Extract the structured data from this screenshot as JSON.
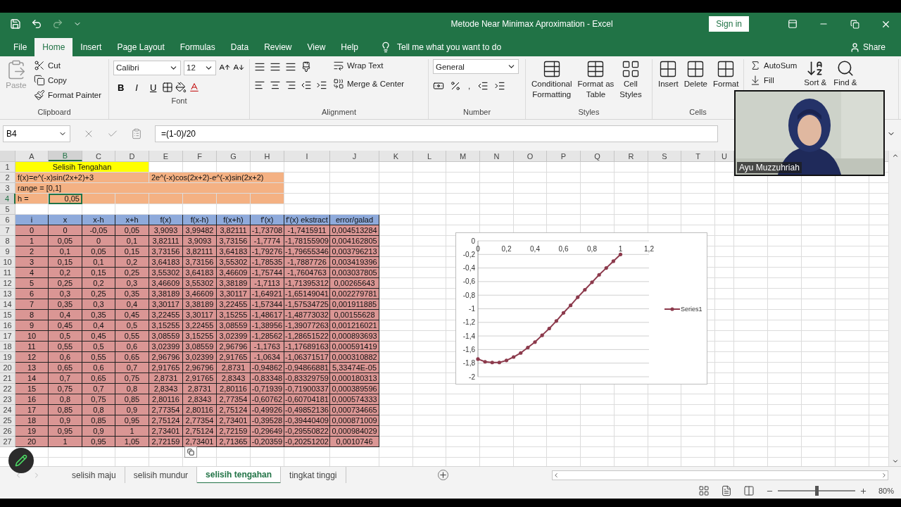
{
  "window": {
    "title": "Metode Near Minimax Aproximation  -  Excel",
    "sign_in": "Sign in",
    "share": "Share"
  },
  "tabs": [
    {
      "label": "File",
      "selected": false
    },
    {
      "label": "Home",
      "selected": true
    },
    {
      "label": "Insert",
      "selected": false
    },
    {
      "label": "Page Layout",
      "selected": false
    },
    {
      "label": "Formulas",
      "selected": false
    },
    {
      "label": "Data",
      "selected": false
    },
    {
      "label": "Review",
      "selected": false
    },
    {
      "label": "View",
      "selected": false
    },
    {
      "label": "Help",
      "selected": false
    }
  ],
  "tell_me": "Tell me what you want to do",
  "clipboard": {
    "label": "Clipboard",
    "paste": {
      "label": "Paste",
      "disabled": true
    },
    "cut": "Cut",
    "copy": "Copy",
    "format_painter": "Format Painter"
  },
  "font": {
    "label": "Font",
    "name": "Calibri",
    "size": "12",
    "styles": [
      "B",
      "I",
      "U"
    ]
  },
  "alignment": {
    "label": "Alignment",
    "wrap": "Wrap Text",
    "merge": "Merge & Center"
  },
  "number": {
    "label": "Number",
    "format": "General",
    "comma": ","
  },
  "styles": {
    "label": "Styles",
    "buttons": [
      [
        "Conditional",
        "Formatting"
      ],
      [
        "Format as",
        "Table"
      ],
      [
        "Cell",
        "Styles"
      ]
    ]
  },
  "cells": {
    "label": "Cells",
    "buttons": [
      "Insert",
      "Delete",
      "Format"
    ]
  },
  "editing": {
    "autosum": "AutoSum",
    "fill": "Fill",
    "buttons": [
      "Sort &",
      "Find &"
    ]
  },
  "formula_bar": {
    "name_box": "B4",
    "formula": "=(1-0)/20"
  },
  "sheet": {
    "columns": [
      {
        "label": "A",
        "selected": false
      },
      {
        "label": "B",
        "selected": true
      },
      {
        "label": "C",
        "selected": false
      },
      {
        "label": "D",
        "selected": false
      },
      {
        "label": "E",
        "selected": false
      },
      {
        "label": "F",
        "selected": false
      },
      {
        "label": "G",
        "selected": false
      },
      {
        "label": "H",
        "selected": false
      },
      {
        "label": "I",
        "selected": false
      },
      {
        "label": "J",
        "selected": false
      },
      {
        "label": "K",
        "selected": false
      },
      {
        "label": "L",
        "selected": false
      },
      {
        "label": "M",
        "selected": false
      },
      {
        "label": "N",
        "selected": false
      },
      {
        "label": "O",
        "selected": false
      },
      {
        "label": "P",
        "selected": false
      },
      {
        "label": "Q",
        "selected": false
      },
      {
        "label": "R",
        "selected": false
      },
      {
        "label": "S",
        "selected": false
      },
      {
        "label": "T",
        "selected": false
      },
      {
        "label": "U",
        "selected": false
      }
    ],
    "rows": [
      {
        "label": "1",
        "selected": false,
        "kind": "title",
        "cells": [
          {
            "text": "Selisih Tengahan"
          },
          {
            "text": ""
          },
          {
            "text": ""
          },
          {
            "text": ""
          }
        ]
      },
      {
        "label": "2",
        "selected": false,
        "kind": "note",
        "cells": [
          {
            "text": "f(x)=e^(-x)sin(2x+2)+3"
          },
          {
            "text": ""
          },
          {
            "text": ""
          },
          {
            "text": ""
          },
          {
            "text": "2e^(-x)cos(2x+2)-e^(-x)sin(2x+2)"
          },
          {
            "text": ""
          },
          {
            "text": ""
          },
          {
            "text": ""
          }
        ]
      },
      {
        "label": "3",
        "selected": false,
        "kind": "note",
        "cells": [
          {
            "text": "range = [0,1]"
          },
          {
            "text": ""
          },
          {
            "text": ""
          },
          {
            "text": ""
          },
          {
            "text": ""
          },
          {
            "text": ""
          },
          {
            "text": ""
          },
          {
            "text": ""
          }
        ]
      },
      {
        "label": "4",
        "selected": true,
        "kind": "note",
        "cells": [
          {
            "text": "h =",
            "selected": false
          },
          {
            "text": "0,05",
            "selected": true
          }
        ]
      },
      {
        "label": "5",
        "selected": false,
        "kind": "blank",
        "cells": []
      },
      {
        "label": "6",
        "selected": false,
        "kind": "header",
        "cells": [
          {
            "text": "i"
          },
          {
            "text": "x"
          },
          {
            "text": "x-h"
          },
          {
            "text": "x+h"
          },
          {
            "text": "f(x)"
          },
          {
            "text": "f(x-h)"
          },
          {
            "text": "f(x+h)"
          },
          {
            "text": "f'(x)"
          },
          {
            "text": "f'(x) ekstract"
          },
          {
            "text": "error/galad"
          }
        ]
      },
      {
        "label": "7",
        "selected": false,
        "kind": "data",
        "cells": [
          {
            "text": "0"
          },
          {
            "text": "0"
          },
          {
            "text": "-0,05"
          },
          {
            "text": "0,05"
          },
          {
            "text": "3,9093"
          },
          {
            "text": "3,99482"
          },
          {
            "text": "3,82111"
          },
          {
            "text": "-1,73708"
          },
          {
            "text": "-1,7415911"
          },
          {
            "text": "0,004513284"
          }
        ]
      },
      {
        "label": "8",
        "selected": false,
        "kind": "data",
        "cells": [
          {
            "text": "1"
          },
          {
            "text": "0,05"
          },
          {
            "text": "0"
          },
          {
            "text": "0,1"
          },
          {
            "text": "3,82111"
          },
          {
            "text": "3,9093"
          },
          {
            "text": "3,73156"
          },
          {
            "text": "-1,7774"
          },
          {
            "text": "-1,78155909"
          },
          {
            "text": "0,004162805"
          }
        ]
      },
      {
        "label": "9",
        "selected": false,
        "kind": "data",
        "cells": [
          {
            "text": "2"
          },
          {
            "text": "0,1"
          },
          {
            "text": "0,05"
          },
          {
            "text": "0,15"
          },
          {
            "text": "3,73156"
          },
          {
            "text": "3,82111"
          },
          {
            "text": "3,64183"
          },
          {
            "text": "-1,79276"
          },
          {
            "text": "-1,79655346"
          },
          {
            "text": "0,003796213"
          }
        ]
      },
      {
        "label": "10",
        "selected": false,
        "kind": "data",
        "cells": [
          {
            "text": "3"
          },
          {
            "text": "0,15"
          },
          {
            "text": "0,1"
          },
          {
            "text": "0,2"
          },
          {
            "text": "3,64183"
          },
          {
            "text": "3,73156"
          },
          {
            "text": "3,55302"
          },
          {
            "text": "-1,78535"
          },
          {
            "text": "-1,7887726"
          },
          {
            "text": "0,003419396"
          }
        ]
      },
      {
        "label": "11",
        "selected": false,
        "kind": "data",
        "cells": [
          {
            "text": "4"
          },
          {
            "text": "0,2"
          },
          {
            "text": "0,15"
          },
          {
            "text": "0,25"
          },
          {
            "text": "3,55302"
          },
          {
            "text": "3,64183"
          },
          {
            "text": "3,46609"
          },
          {
            "text": "-1,75744"
          },
          {
            "text": "-1,7604763"
          },
          {
            "text": "0,003037805"
          }
        ]
      },
      {
        "label": "12",
        "selected": false,
        "kind": "data",
        "cells": [
          {
            "text": "5"
          },
          {
            "text": "0,25"
          },
          {
            "text": "0,2"
          },
          {
            "text": "0,3"
          },
          {
            "text": "3,46609"
          },
          {
            "text": "3,55302"
          },
          {
            "text": "3,38189"
          },
          {
            "text": "-1,7113"
          },
          {
            "text": "-1,71395312"
          },
          {
            "text": "0,00265643"
          }
        ]
      },
      {
        "label": "13",
        "selected": false,
        "kind": "data",
        "cells": [
          {
            "text": "6"
          },
          {
            "text": "0,3"
          },
          {
            "text": "0,25"
          },
          {
            "text": "0,35"
          },
          {
            "text": "3,38189"
          },
          {
            "text": "3,46609"
          },
          {
            "text": "3,30117"
          },
          {
            "text": "-1,64921"
          },
          {
            "text": "-1,65149041"
          },
          {
            "text": "0,002279781"
          }
        ]
      },
      {
        "label": "14",
        "selected": false,
        "kind": "data",
        "cells": [
          {
            "text": "7"
          },
          {
            "text": "0,35"
          },
          {
            "text": "0,3"
          },
          {
            "text": "0,4"
          },
          {
            "text": "3,30117"
          },
          {
            "text": "3,38189"
          },
          {
            "text": "3,22455"
          },
          {
            "text": "-1,57344"
          },
          {
            "text": "-1,57534725"
          },
          {
            "text": "0,001911885"
          }
        ]
      },
      {
        "label": "15",
        "selected": false,
        "kind": "data",
        "cells": [
          {
            "text": "8"
          },
          {
            "text": "0,4"
          },
          {
            "text": "0,35"
          },
          {
            "text": "0,45"
          },
          {
            "text": "3,22455"
          },
          {
            "text": "3,30117"
          },
          {
            "text": "3,15255"
          },
          {
            "text": "-1,48617"
          },
          {
            "text": "-1,48773032"
          },
          {
            "text": "0,00155628"
          }
        ]
      },
      {
        "label": "16",
        "selected": false,
        "kind": "data",
        "cells": [
          {
            "text": "9"
          },
          {
            "text": "0,45"
          },
          {
            "text": "0,4"
          },
          {
            "text": "0,5"
          },
          {
            "text": "3,15255"
          },
          {
            "text": "3,22455"
          },
          {
            "text": "3,08559"
          },
          {
            "text": "-1,38956"
          },
          {
            "text": "-1,39077263"
          },
          {
            "text": "0,001216021"
          }
        ]
      },
      {
        "label": "17",
        "selected": false,
        "kind": "data",
        "cells": [
          {
            "text": "10"
          },
          {
            "text": "0,5"
          },
          {
            "text": "0,45"
          },
          {
            "text": "0,55"
          },
          {
            "text": "3,08559"
          },
          {
            "text": "3,15255"
          },
          {
            "text": "3,02399"
          },
          {
            "text": "-1,28562"
          },
          {
            "text": "-1,28651522"
          },
          {
            "text": "0,000893693"
          }
        ]
      },
      {
        "label": "18",
        "selected": false,
        "kind": "data",
        "cells": [
          {
            "text": "11"
          },
          {
            "text": "0,55"
          },
          {
            "text": "0,5"
          },
          {
            "text": "0,6"
          },
          {
            "text": "3,02399"
          },
          {
            "text": "3,08559"
          },
          {
            "text": "2,96796"
          },
          {
            "text": "-1,1763"
          },
          {
            "text": "-1,17689163"
          },
          {
            "text": "0,000591419"
          }
        ]
      },
      {
        "label": "19",
        "selected": false,
        "kind": "data",
        "cells": [
          {
            "text": "12"
          },
          {
            "text": "0,6"
          },
          {
            "text": "0,55"
          },
          {
            "text": "0,65"
          },
          {
            "text": "2,96796"
          },
          {
            "text": "3,02399"
          },
          {
            "text": "2,91765"
          },
          {
            "text": "-1,0634"
          },
          {
            "text": "-1,06371517"
          },
          {
            "text": "0,000310882"
          }
        ]
      },
      {
        "label": "20",
        "selected": false,
        "kind": "data",
        "cells": [
          {
            "text": "13"
          },
          {
            "text": "0,65"
          },
          {
            "text": "0,6"
          },
          {
            "text": "0,7"
          },
          {
            "text": "2,91765"
          },
          {
            "text": "2,96796"
          },
          {
            "text": "2,8731"
          },
          {
            "text": "-0,94862"
          },
          {
            "text": "-0,94866881"
          },
          {
            "text": "5,33474E-05"
          }
        ]
      },
      {
        "label": "21",
        "selected": false,
        "kind": "data",
        "cells": [
          {
            "text": "14"
          },
          {
            "text": "0,7"
          },
          {
            "text": "0,65"
          },
          {
            "text": "0,75"
          },
          {
            "text": "2,8731"
          },
          {
            "text": "2,91765"
          },
          {
            "text": "2,8343"
          },
          {
            "text": "-0,83348"
          },
          {
            "text": "-0,83329759"
          },
          {
            "text": "0,000180313"
          }
        ]
      },
      {
        "label": "22",
        "selected": false,
        "kind": "data",
        "cells": [
          {
            "text": "15"
          },
          {
            "text": "0,75"
          },
          {
            "text": "0,7"
          },
          {
            "text": "0,8"
          },
          {
            "text": "2,8343"
          },
          {
            "text": "2,8731"
          },
          {
            "text": "2,80116"
          },
          {
            "text": "-0,71939"
          },
          {
            "text": "-0,71900337"
          },
          {
            "text": "0,000389596"
          }
        ]
      },
      {
        "label": "23",
        "selected": false,
        "kind": "data",
        "cells": [
          {
            "text": "16"
          },
          {
            "text": "0,8"
          },
          {
            "text": "0,75"
          },
          {
            "text": "0,85"
          },
          {
            "text": "2,80116"
          },
          {
            "text": "2,8343"
          },
          {
            "text": "2,77354"
          },
          {
            "text": "-0,60762"
          },
          {
            "text": "-0,60704181"
          },
          {
            "text": "0,000574333"
          }
        ]
      },
      {
        "label": "24",
        "selected": false,
        "kind": "data",
        "cells": [
          {
            "text": "17"
          },
          {
            "text": "0,85"
          },
          {
            "text": "0,8"
          },
          {
            "text": "0,9"
          },
          {
            "text": "2,77354"
          },
          {
            "text": "2,80116"
          },
          {
            "text": "2,75124"
          },
          {
            "text": "-0,49926"
          },
          {
            "text": "-0,49852136"
          },
          {
            "text": "0,000734665"
          }
        ]
      },
      {
        "label": "25",
        "selected": false,
        "kind": "data",
        "cells": [
          {
            "text": "18"
          },
          {
            "text": "0,9"
          },
          {
            "text": "0,85"
          },
          {
            "text": "0,95"
          },
          {
            "text": "2,75124"
          },
          {
            "text": "2,77354"
          },
          {
            "text": "2,73401"
          },
          {
            "text": "-0,39528"
          },
          {
            "text": "-0,39440409"
          },
          {
            "text": "0,000871009"
          }
        ]
      },
      {
        "label": "26",
        "selected": false,
        "kind": "data",
        "cells": [
          {
            "text": "19"
          },
          {
            "text": "0,95"
          },
          {
            "text": "0,9"
          },
          {
            "text": "1"
          },
          {
            "text": "2,73401"
          },
          {
            "text": "2,75124"
          },
          {
            "text": "2,72159"
          },
          {
            "text": "-0,29649"
          },
          {
            "text": "-0,29550822"
          },
          {
            "text": "0,000984029"
          }
        ]
      },
      {
        "label": "27",
        "selected": false,
        "kind": "data",
        "cells": [
          {
            "text": "20"
          },
          {
            "text": "1"
          },
          {
            "text": "0,95"
          },
          {
            "text": "1,05"
          },
          {
            "text": "2,72159"
          },
          {
            "text": "2,73401"
          },
          {
            "text": "2,71365"
          },
          {
            "text": "-0,20359"
          },
          {
            "text": "-0,20251202"
          },
          {
            "text": "0,0010746"
          }
        ]
      }
    ]
  },
  "chart": {
    "chart_data": {
      "type": "line",
      "legend": true,
      "grid": true,
      "x": [
        0,
        0.05,
        0.1,
        0.15,
        0.2,
        0.25,
        0.3,
        0.35,
        0.4,
        0.45,
        0.5,
        0.55,
        0.6,
        0.65,
        0.7,
        0.75,
        0.8,
        0.85,
        0.9,
        0.95,
        1
      ],
      "xlim": [
        0,
        1.2
      ],
      "ylim": [
        -2,
        0
      ],
      "xticks": [
        {
          "value": 0,
          "label": "0"
        },
        {
          "value": 0.2,
          "label": "0,2"
        },
        {
          "value": 0.4,
          "label": "0,4"
        },
        {
          "value": 0.6,
          "label": "0,6"
        },
        {
          "value": 0.8,
          "label": "0,8"
        },
        {
          "value": 1,
          "label": "1"
        },
        {
          "value": 1.2,
          "label": "1,2"
        }
      ],
      "yticks": [
        {
          "value": 0,
          "label": "0"
        },
        {
          "value": -0.2,
          "label": "-0,2"
        },
        {
          "value": -0.4,
          "label": "-0,4"
        },
        {
          "value": -0.6,
          "label": "-0,6"
        },
        {
          "value": -0.8,
          "label": "-0,8"
        },
        {
          "value": -1,
          "label": "-1"
        },
        {
          "value": -1.2,
          "label": "-1,2"
        },
        {
          "value": -1.4,
          "label": "-1,4"
        },
        {
          "value": -1.6,
          "label": "-1,6"
        },
        {
          "value": -1.8,
          "label": "-1,8"
        },
        {
          "value": -2,
          "label": "-2"
        }
      ],
      "series": [
        {
          "name": "Series1",
          "color": "#8c3a4c",
          "values": [
            -1.74,
            -1.78,
            -1.79,
            -1.79,
            -1.76,
            -1.71,
            -1.65,
            -1.57,
            -1.49,
            -1.39,
            -1.29,
            -1.18,
            -1.06,
            -0.95,
            -0.83,
            -0.72,
            -0.61,
            -0.5,
            -0.4,
            -0.3,
            -0.2
          ]
        }
      ]
    }
  },
  "sheet_tabs": [
    {
      "label": "selisih maju",
      "selected": false
    },
    {
      "label": "selisih mundur",
      "selected": false
    },
    {
      "label": "selisih tengahan",
      "selected": true
    },
    {
      "label": "tingkat tinggi",
      "selected": false
    }
  ],
  "status_bar": {
    "zoom": {
      "level": 0.5,
      "reading": "80%"
    }
  },
  "webcam": {
    "kind": "picture",
    "name": "Ayu Muzzuhriah"
  }
}
